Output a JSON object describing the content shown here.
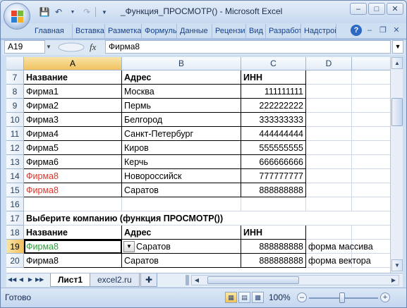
{
  "window": {
    "title": "_Функция_ПРОСМОТР() - Microsoft Excel",
    "controls": [
      "minimize",
      "maximize",
      "close"
    ]
  },
  "ribbon": {
    "tabs": [
      "Главная",
      "Вставка",
      "Разметка",
      "Формулы",
      "Данные",
      "Рецензирование",
      "Вид",
      "Разработчик",
      "Надстройки"
    ]
  },
  "formula_bar": {
    "name_box": "A19",
    "fx": "fx",
    "content": "Фирма8"
  },
  "grid": {
    "columns": [
      "A",
      "B",
      "C",
      "D"
    ],
    "selected_column": "A",
    "selected_row": "19",
    "rows": [
      {
        "num": "7",
        "a": "Название",
        "b": "Адрес",
        "c": "ИНН",
        "d": ""
      },
      {
        "num": "8",
        "a": "Фирма1",
        "b": "Москва",
        "c": "111111111",
        "d": ""
      },
      {
        "num": "9",
        "a": "Фирма2",
        "b": "Пермь",
        "c": "222222222",
        "d": ""
      },
      {
        "num": "10",
        "a": "Фирма3",
        "b": "Белгород",
        "c": "333333333",
        "d": ""
      },
      {
        "num": "11",
        "a": "Фирма4",
        "b": "Санкт-Петербург",
        "c": "444444444",
        "d": ""
      },
      {
        "num": "12",
        "a": "Фирма5",
        "b": "Киров",
        "c": "555555555",
        "d": ""
      },
      {
        "num": "13",
        "a": "Фирма6",
        "b": "Керчь",
        "c": "666666666",
        "d": ""
      },
      {
        "num": "14",
        "a": "Фирма8",
        "b": "Новороссийск",
        "c": "777777777",
        "d": ""
      },
      {
        "num": "15",
        "a": "Фирма8",
        "b": "Саратов",
        "c": "888888888",
        "d": ""
      },
      {
        "num": "16",
        "a": "",
        "b": "",
        "c": "",
        "d": ""
      },
      {
        "num": "17",
        "a": "Выберите компанию (функция ПРОСМОТР())",
        "b": "",
        "c": "",
        "d": ""
      },
      {
        "num": "18",
        "a": "Название",
        "b": "Адрес",
        "c": "ИНН",
        "d": ""
      },
      {
        "num": "19",
        "a": "Фирма8",
        "b": "Саратов",
        "c": "888888888",
        "d": "форма массива"
      },
      {
        "num": "20",
        "a": "Фирма8",
        "b": "Саратов",
        "c": "888888888",
        "d": "форма вектора"
      }
    ]
  },
  "sheets": {
    "tabs": [
      "Лист1",
      "excel2.ru"
    ],
    "active": "Лист1"
  },
  "status": {
    "ready": "Готово",
    "zoom": "100%",
    "zoom_level_percent": 100
  },
  "colors": {
    "red_text": "#e0342a",
    "green_text": "#2aa236",
    "selection": "#f1c15f"
  }
}
